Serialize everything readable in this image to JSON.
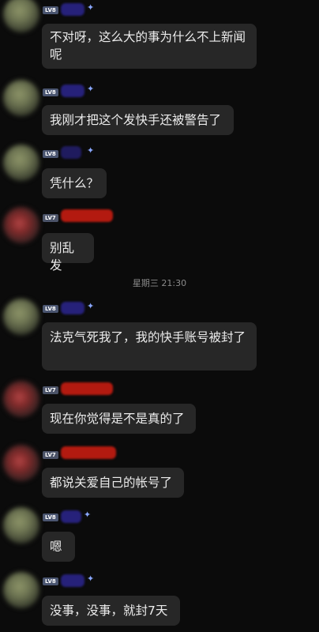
{
  "timestamp": "星期三 21:30",
  "messages": [
    {
      "level": "LV8",
      "text": "不对呀，这么大的事为什么不上新闻呢"
    },
    {
      "level": "LV8",
      "text": "我刚才把这个发快手还被警告了"
    },
    {
      "level": "LV8",
      "text": "凭什么？"
    },
    {
      "level": "LV7",
      "text": "别乱发"
    },
    {
      "level": "LV8",
      "text": "法克气死我了，我的快手账号被封了"
    },
    {
      "level": "LV7",
      "text": "现在你觉得是不是真的了"
    },
    {
      "level": "LV7",
      "text": "都说关爱自己的帐号了"
    },
    {
      "level": "LV8",
      "text": "嗯"
    },
    {
      "level": "LV8",
      "text": "没事，没事，就封7天"
    }
  ],
  "colors": {
    "background": "#0b0b0b",
    "bubble": "#272727",
    "level_badge": "#4a5570",
    "name_blur_blue": "#26217a",
    "name_blur_red": "#b31a10"
  }
}
